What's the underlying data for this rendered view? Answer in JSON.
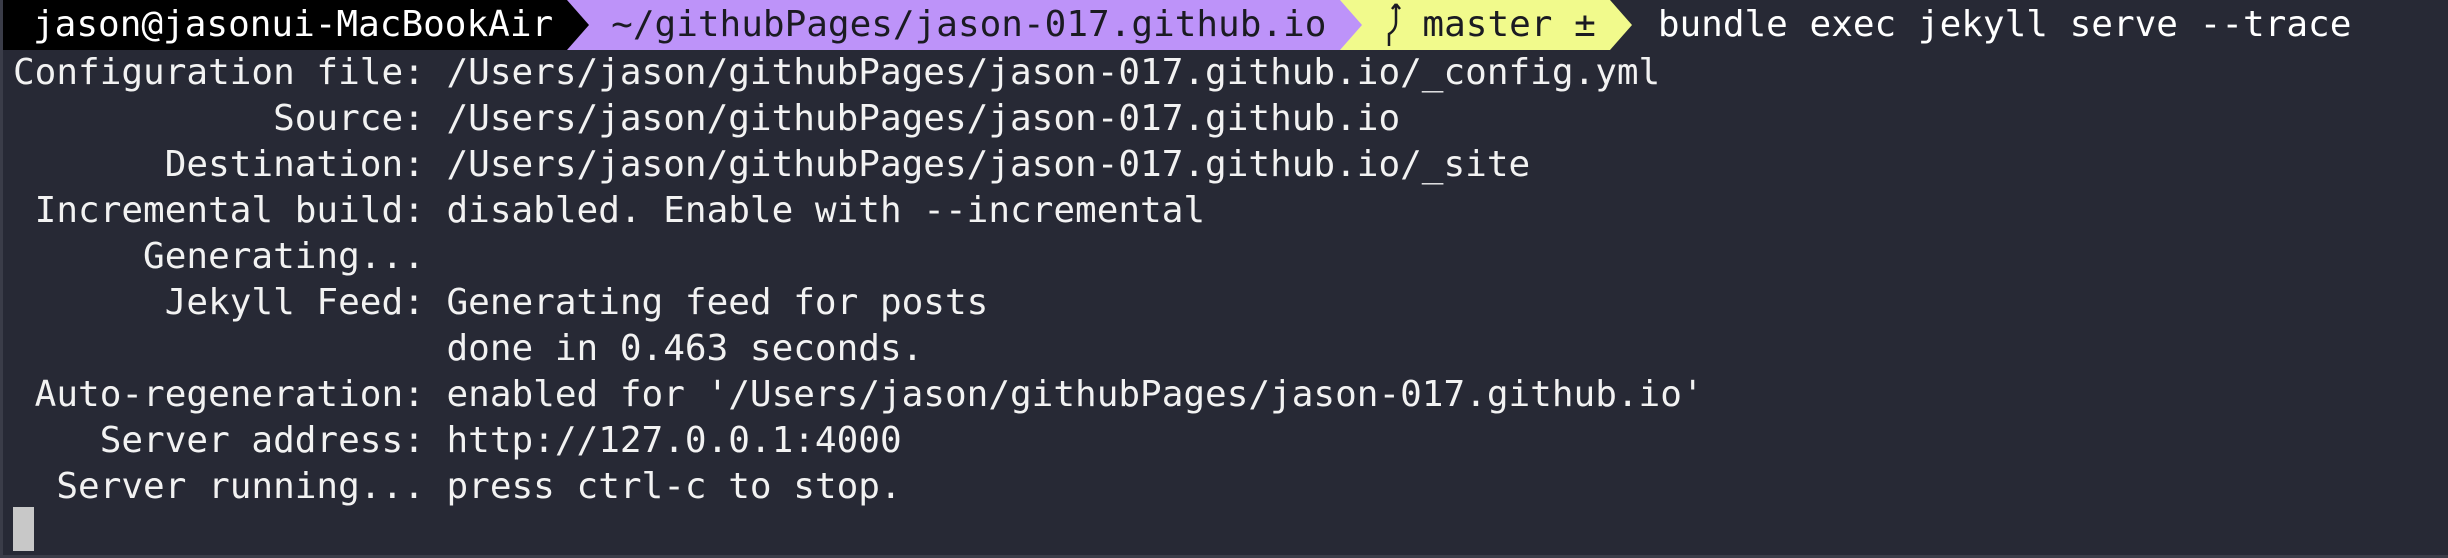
{
  "prompt": {
    "user_host": "jason@jasonui-MacBookAir",
    "directory": "~/githubPages/jason-017.github.io",
    "git_branch": "master ±",
    "command": "bundle exec jekyll serve --trace",
    "icons": {
      "branch": "git-branch-icon"
    },
    "colors": {
      "user_bg": "#000000",
      "dir_bg": "#bd93f9",
      "git_bg": "#f1fa8c",
      "terminal_bg": "#272935"
    }
  },
  "output": {
    "lines": [
      "Configuration file: /Users/jason/githubPages/jason-017.github.io/_config.yml",
      "            Source: /Users/jason/githubPages/jason-017.github.io",
      "       Destination: /Users/jason/githubPages/jason-017.github.io/_site",
      " Incremental build: disabled. Enable with --incremental",
      "      Generating...",
      "       Jekyll Feed: Generating feed for posts",
      "                    done in 0.463 seconds.",
      " Auto-regeneration: enabled for '/Users/jason/githubPages/jason-017.github.io'",
      "    Server address: http://127.0.0.1:4000",
      "  Server running... press ctrl-c to stop."
    ]
  }
}
